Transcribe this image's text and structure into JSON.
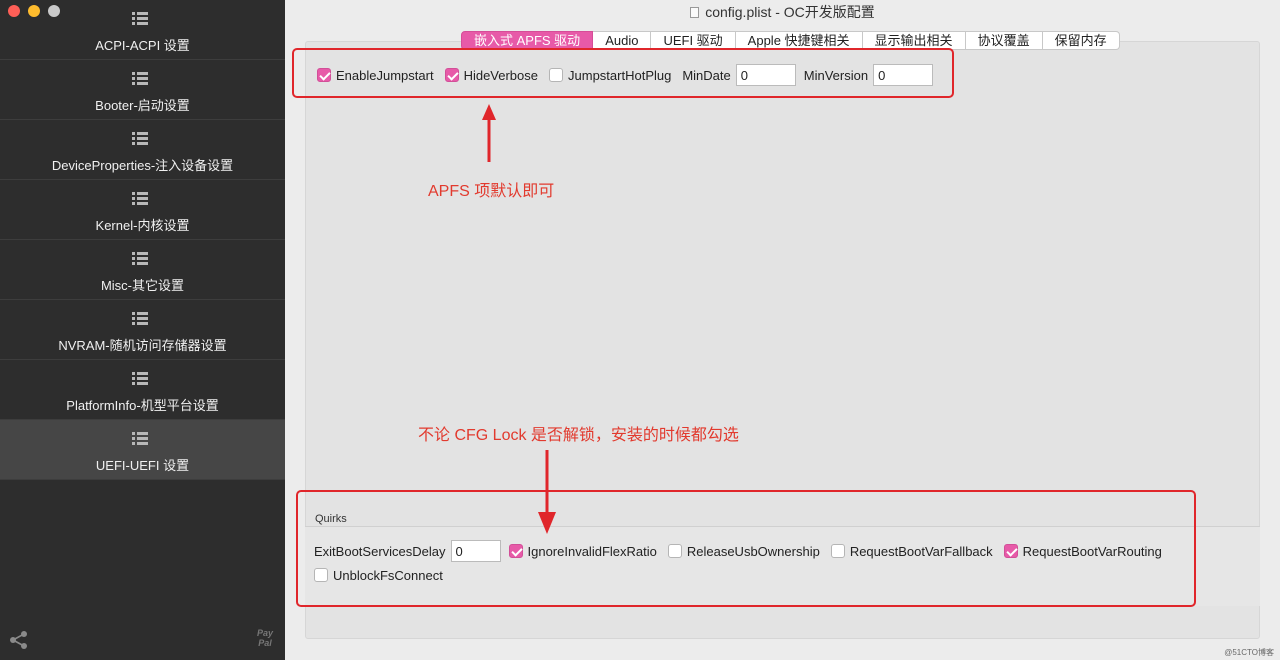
{
  "window": {
    "title": "config.plist - OC开发版配置"
  },
  "sidebar": {
    "items": [
      {
        "label": "ACPI-ACPI 设置"
      },
      {
        "label": "Booter-启动设置"
      },
      {
        "label": "DeviceProperties-注入设备设置"
      },
      {
        "label": "Kernel-内核设置"
      },
      {
        "label": "Misc-其它设置"
      },
      {
        "label": "NVRAM-随机访问存储器设置"
      },
      {
        "label": "PlatformInfo-机型平台设置"
      },
      {
        "label": "UEFI-UEFI 设置"
      }
    ],
    "active_index": 7,
    "paypal_text": "Pay Pal"
  },
  "tabs": [
    {
      "label": "嵌入式 APFS 驱动",
      "active": true
    },
    {
      "label": "Audio",
      "active": false
    },
    {
      "label": "UEFI 驱动",
      "active": false
    },
    {
      "label": "Apple 快捷键相关",
      "active": false
    },
    {
      "label": "显示输出相关",
      "active": false
    },
    {
      "label": "协议覆盖",
      "active": false
    },
    {
      "label": "保留内存",
      "active": false
    }
  ],
  "apfs": {
    "enable_jumpstart": {
      "label": "EnableJumpstart",
      "checked": true
    },
    "hide_verbose": {
      "label": "HideVerbose",
      "checked": true
    },
    "jumpstart_hotplug": {
      "label": "JumpstartHotPlug",
      "checked": false
    },
    "min_date": {
      "label": "MinDate",
      "value": "0"
    },
    "min_version": {
      "label": "MinVersion",
      "value": "0"
    }
  },
  "quirks": {
    "section_label": "Quirks",
    "exit_boot_services_delay": {
      "label": "ExitBootServicesDelay",
      "value": "0"
    },
    "ignore_invalid_flex_ratio": {
      "label": "IgnoreInvalidFlexRatio",
      "checked": true
    },
    "release_usb_ownership": {
      "label": "ReleaseUsbOwnership",
      "checked": false
    },
    "request_boot_var_fallback": {
      "label": "RequestBootVarFallback",
      "checked": false
    },
    "request_boot_var_routing": {
      "label": "RequestBootVarRouting",
      "checked": true
    },
    "unblock_fs_connect": {
      "label": "UnblockFsConnect",
      "checked": false
    }
  },
  "annotations": {
    "apfs_note": "APFS 项默认即可",
    "quirks_note": "不论 CFG Lock 是否解锁，安装的时候都勾选"
  },
  "watermark": "@51CTO博客",
  "colors": {
    "accent": "#e75aa8",
    "annotation_red": "#e0262b",
    "sidebar_bg": "#2d2d2d"
  }
}
